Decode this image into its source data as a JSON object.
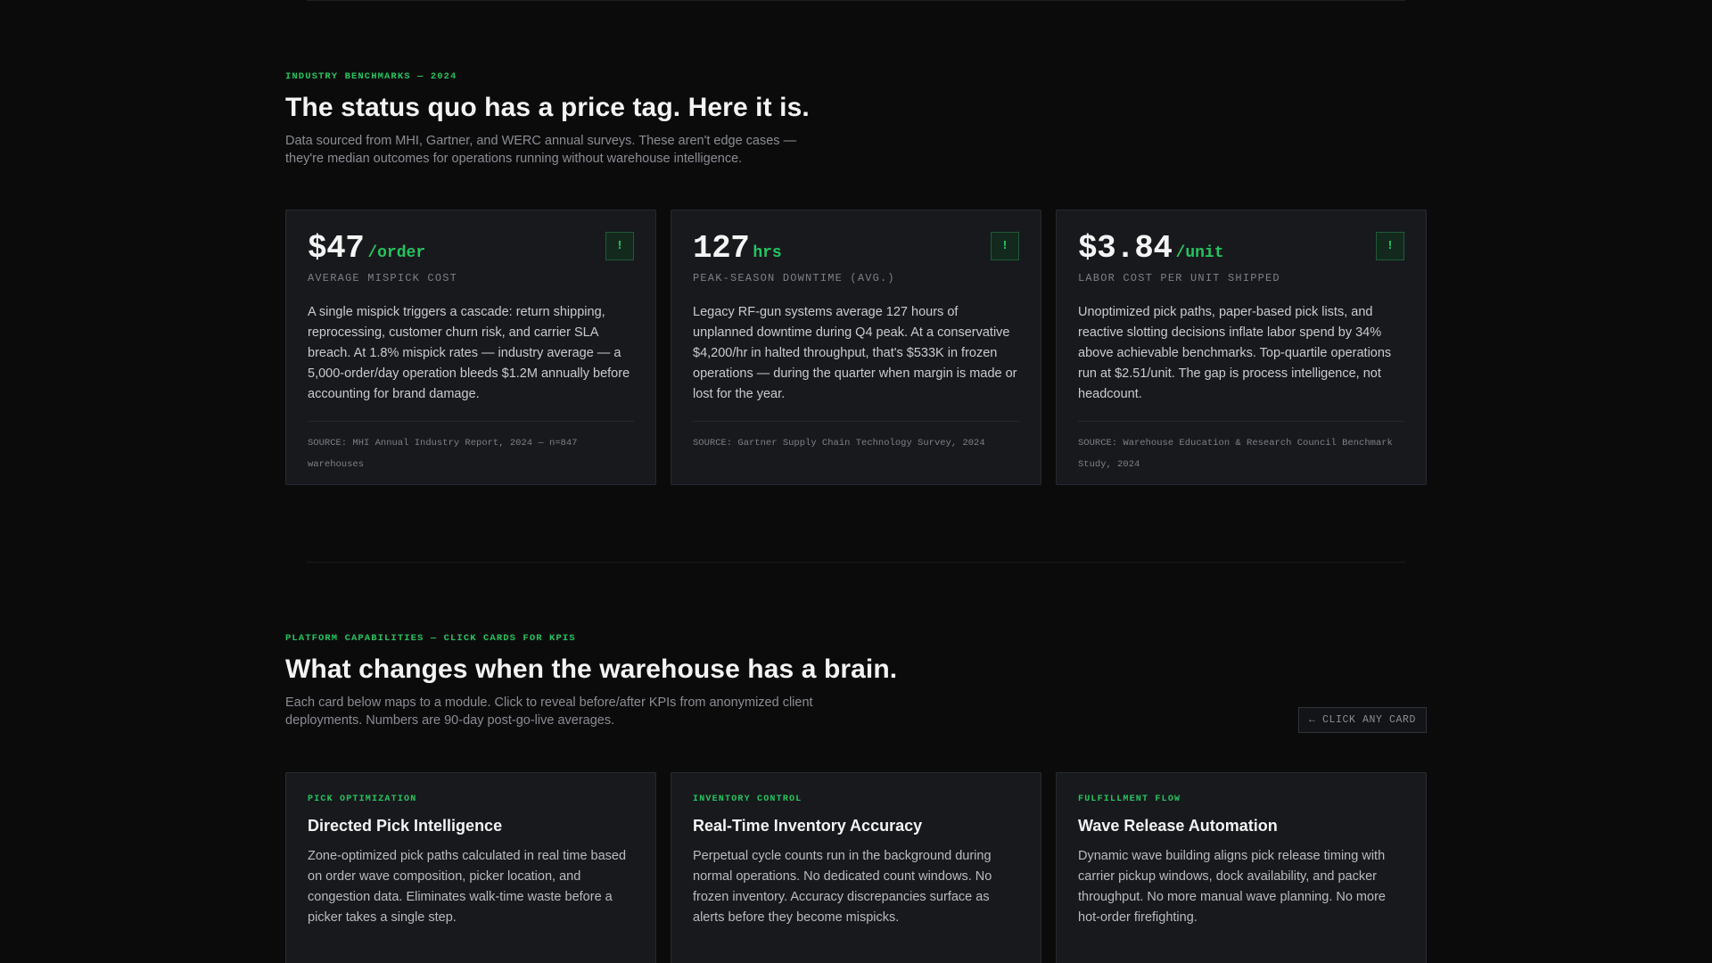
{
  "benchmarks": {
    "eyebrow": "INDUSTRY BENCHMARKS — 2024",
    "title": "The status quo has a price tag. Here it is.",
    "lead": "Data sourced from MHI, Gartner, and WERC annual surveys. These aren't edge cases — they're median outcomes for operations running without warehouse intelligence.",
    "cards": [
      {
        "value": "$47",
        "unit": "/order",
        "label": "AVERAGE MISPICK COST",
        "badge": "!",
        "body": "A single mispick triggers a cascade: return shipping, reprocessing, customer churn risk, and carrier SLA breach. At 1.8% mispick rates — industry average — a 5,000-order/day operation bleeds $1.2M annually before accounting for brand damage.",
        "source": "SOURCE: MHI Annual Industry Report, 2024 — n=847 warehouses"
      },
      {
        "value": "127",
        "unit": "hrs",
        "label": "PEAK-SEASON DOWNTIME (AVG.)",
        "badge": "!",
        "body": "Legacy RF-gun systems average 127 hours of unplanned downtime during Q4 peak. At a conservative $4,200/hr in halted throughput, that's $533K in frozen operations — during the quarter when margin is made or lost for the year.",
        "source": "SOURCE: Gartner Supply Chain Technology Survey, 2024"
      },
      {
        "value": "$3.84",
        "unit": "/unit",
        "label": "LABOR COST PER UNIT SHIPPED",
        "badge": "!",
        "body": "Unoptimized pick paths, paper-based pick lists, and reactive slotting decisions inflate labor spend by 34% above achievable benchmarks. Top-quartile operations run at $2.51/unit. The gap is process intelligence, not headcount.",
        "source": "SOURCE: Warehouse Education & Research Council Benchmark Study, 2024"
      }
    ]
  },
  "capabilities": {
    "eyebrow": "PLATFORM CAPABILITIES — CLICK CARDS FOR KPIS",
    "title": "What changes when the warehouse has a brain.",
    "lead": "Each card below maps to a module. Click to reveal before/after KPIs from anonymized client deployments. Numbers are 90-day post-go-live averages.",
    "hint": "← CLICK ANY CARD",
    "cards": [
      {
        "tag": "PICK OPTIMIZATION",
        "title": "Directed Pick Intelligence",
        "body": "Zone-optimized pick paths calculated in real time based on order wave composition, picker location, and congestion data. Eliminates walk-time waste before a picker takes a single step."
      },
      {
        "tag": "INVENTORY CONTROL",
        "title": "Real-Time Inventory Accuracy",
        "body": "Perpetual cycle counts run in the background during normal operations. No dedicated count windows. No frozen inventory. Accuracy discrepancies surface as alerts before they become mispicks."
      },
      {
        "tag": "FULFILLMENT FLOW",
        "title": "Wave Release Automation",
        "body": "Dynamic wave building aligns pick release timing with carrier pickup windows, dock availability, and packer throughput. No more manual wave planning. No more hot-order firefighting."
      }
    ]
  },
  "colors": {
    "background": "#0b0b0c",
    "card": "#17191d",
    "accent": "#22c55e",
    "muted_text": "#8b8d93"
  }
}
